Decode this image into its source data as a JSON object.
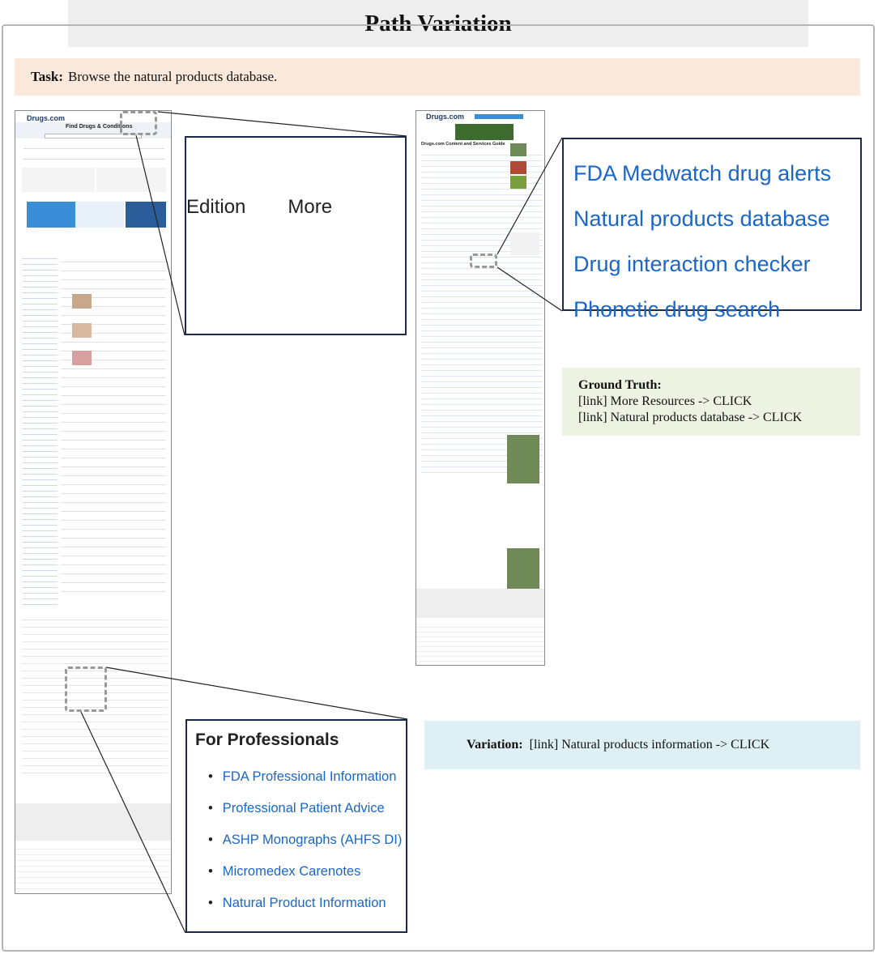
{
  "title": "Path Variation",
  "task": {
    "label": "Task:",
    "text": "Browse the natural products database."
  },
  "left_screenshot": {
    "logo": "Drugs.com",
    "heading": "Find Drugs & Conditions",
    "callout_nav": [
      "Edition",
      "More"
    ],
    "callout_pro": {
      "heading": "For Professionals",
      "items": [
        "FDA Professional Information",
        "Professional Patient Advice",
        "ASHP Monographs (AHFS DI)",
        "Micromedex Carenotes",
        "Natural Product Information"
      ]
    }
  },
  "right_screenshot": {
    "logo": "Drugs.com",
    "heading": "Drugs.com Content and Services Guide",
    "callout_links": [
      "FDA Medwatch drug alerts",
      "Natural products database",
      "Drug interaction checker",
      "Phonetic drug search"
    ]
  },
  "ground_truth": {
    "label": "Ground Truth:",
    "steps": [
      "[link]  More Resources -> CLICK",
      "[link]  Natural products database -> CLICK"
    ]
  },
  "variation": {
    "label": "Variation:",
    "text": "[link]  Natural products information -> CLICK"
  }
}
